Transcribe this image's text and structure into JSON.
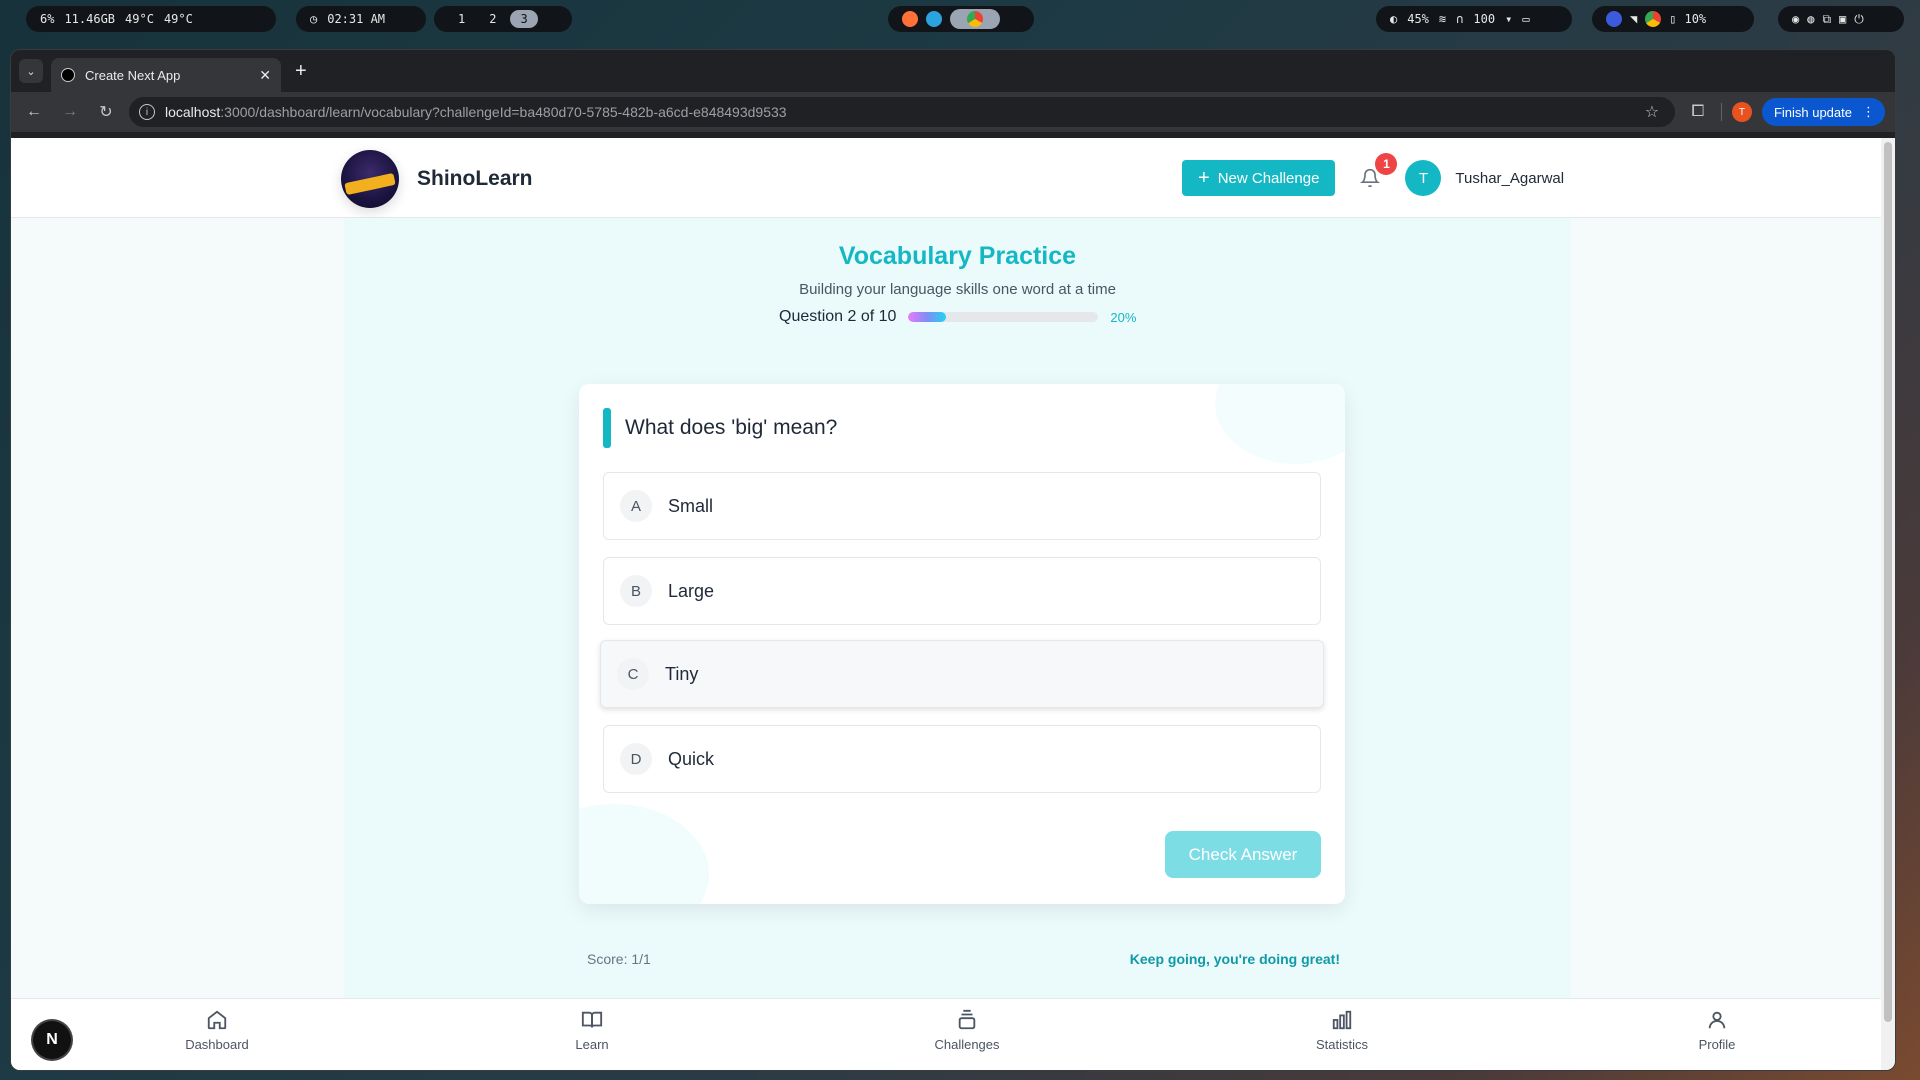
{
  "system_bar": {
    "stats": [
      "6%",
      "11.46GB",
      "49°C",
      "49°C"
    ],
    "clock": "02:31 AM",
    "workspaces": [
      "1",
      "2",
      "3"
    ],
    "active_workspace": "3",
    "right_stats": [
      "45%",
      "100"
    ],
    "battery": "10%"
  },
  "browser": {
    "tab_title": "Create Next App",
    "url_host": "localhost",
    "url_path": ":3000/dashboard/learn/vocabulary?challengeId=ba480d70-5785-482b-a6cd-e848493d9533",
    "profile_initial": "T",
    "update_label": "Finish update"
  },
  "header": {
    "brand": "ShinoLearn",
    "new_challenge": "New Challenge",
    "notification_count": "1",
    "user_initial": "T",
    "user_name": "Tushar_Agarwal"
  },
  "practice": {
    "title": "Vocabulary Practice",
    "subtitle": "Building your language skills one word at a time",
    "question_count": "Question 2 of 10",
    "progress_percent": "20%",
    "progress_fraction": 0.2,
    "question": "What does 'big' mean?",
    "options": [
      {
        "letter": "A",
        "text": "Small"
      },
      {
        "letter": "B",
        "text": "Large"
      },
      {
        "letter": "C",
        "text": "Tiny"
      },
      {
        "letter": "D",
        "text": "Quick"
      }
    ],
    "check_button": "Check Answer",
    "score": "Score: 1/1",
    "encouragement": "Keep going, you're doing great!"
  },
  "bottom_nav": {
    "items": [
      "Dashboard",
      "Learn",
      "Challenges",
      "Statistics",
      "Profile"
    ]
  },
  "next_badge": "N",
  "colors": {
    "accent": "#14b8c4",
    "badge": "#ef4444"
  }
}
